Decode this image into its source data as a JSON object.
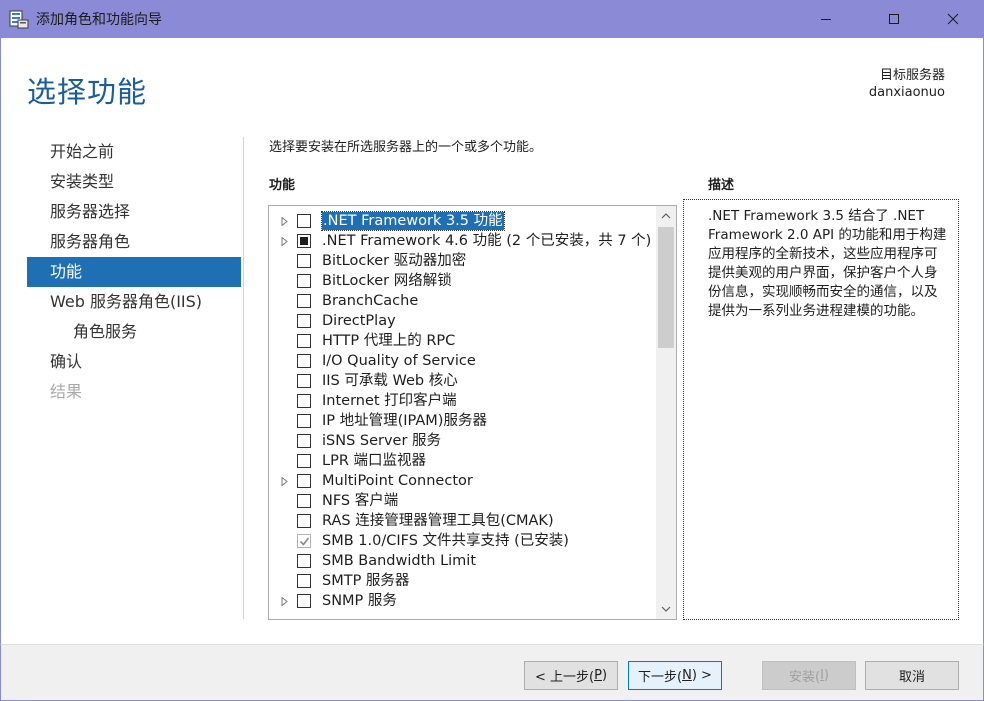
{
  "window": {
    "title": "添加角色和功能向导",
    "controls": [
      "minimize",
      "maximize",
      "close"
    ]
  },
  "header": {
    "page_title": "选择功能",
    "dest_server_label": "目标服务器",
    "dest_server_name": "danxiaonuo"
  },
  "nav": {
    "items": [
      {
        "label": "开始之前",
        "state": "normal"
      },
      {
        "label": "安装类型",
        "state": "normal"
      },
      {
        "label": "服务器选择",
        "state": "normal"
      },
      {
        "label": "服务器角色",
        "state": "normal"
      },
      {
        "label": "功能",
        "state": "active"
      },
      {
        "label": "Web 服务器角色(IIS)",
        "state": "normal"
      },
      {
        "label": "角色服务",
        "state": "sub"
      },
      {
        "label": "确认",
        "state": "normal"
      },
      {
        "label": "结果",
        "state": "disabled"
      }
    ]
  },
  "content": {
    "instruction": "选择要安装在所选服务器上的一个或多个功能。",
    "features_heading": "功能",
    "description_heading": "描述",
    "description": ".NET Framework 3.5 结合了 .NET Framework 2.0 API 的功能和用于构建应用程序的全新技术，这些应用程序可提供美观的用户界面，保护客户个人身份信息，实现顺畅而安全的通信，以及提供为一系列业务进程建模的功能。",
    "features": [
      {
        "label": ".NET Framework 3.5 功能",
        "expandable": true,
        "state": "unchecked",
        "selected": true
      },
      {
        "label": ".NET Framework 4.6 功能 (2 个已安装，共 7 个)",
        "expandable": true,
        "state": "partial",
        "selected": false
      },
      {
        "label": "BitLocker 驱动器加密",
        "expandable": false,
        "state": "unchecked",
        "selected": false
      },
      {
        "label": "BitLocker 网络解锁",
        "expandable": false,
        "state": "unchecked",
        "selected": false
      },
      {
        "label": "BranchCache",
        "expandable": false,
        "state": "unchecked",
        "selected": false
      },
      {
        "label": "DirectPlay",
        "expandable": false,
        "state": "unchecked",
        "selected": false
      },
      {
        "label": "HTTP 代理上的 RPC",
        "expandable": false,
        "state": "unchecked",
        "selected": false
      },
      {
        "label": "I/O Quality of Service",
        "expandable": false,
        "state": "unchecked",
        "selected": false
      },
      {
        "label": "IIS 可承载 Web 核心",
        "expandable": false,
        "state": "unchecked",
        "selected": false
      },
      {
        "label": "Internet 打印客户端",
        "expandable": false,
        "state": "unchecked",
        "selected": false
      },
      {
        "label": "IP 地址管理(IPAM)服务器",
        "expandable": false,
        "state": "unchecked",
        "selected": false
      },
      {
        "label": "iSNS Server 服务",
        "expandable": false,
        "state": "unchecked",
        "selected": false
      },
      {
        "label": "LPR 端口监视器",
        "expandable": false,
        "state": "unchecked",
        "selected": false
      },
      {
        "label": "MultiPoint Connector",
        "expandable": true,
        "state": "unchecked",
        "selected": false
      },
      {
        "label": "NFS 客户端",
        "expandable": false,
        "state": "unchecked",
        "selected": false
      },
      {
        "label": "RAS 连接管理器管理工具包(CMAK)",
        "expandable": false,
        "state": "unchecked",
        "selected": false
      },
      {
        "label": "SMB 1.0/CIFS 文件共享支持 (已安装)",
        "expandable": false,
        "state": "installed",
        "selected": false
      },
      {
        "label": "SMB Bandwidth Limit",
        "expandable": false,
        "state": "unchecked",
        "selected": false
      },
      {
        "label": "SMTP 服务器",
        "expandable": false,
        "state": "unchecked",
        "selected": false
      },
      {
        "label": "SNMP 服务",
        "expandable": true,
        "state": "unchecked",
        "selected": false
      }
    ]
  },
  "footer": {
    "prev_label": "< 上一步(",
    "prev_key": "P",
    "prev_suffix": ")",
    "next_label": "下一步(",
    "next_key": "N",
    "next_suffix": ") >",
    "install_label": "安装(",
    "install_key": "I",
    "install_suffix": ")",
    "cancel_label": "取消"
  },
  "colors": {
    "titlebar": "#8b8ad6",
    "accent": "#1f6fb5",
    "title_text": "#1a5d99"
  }
}
